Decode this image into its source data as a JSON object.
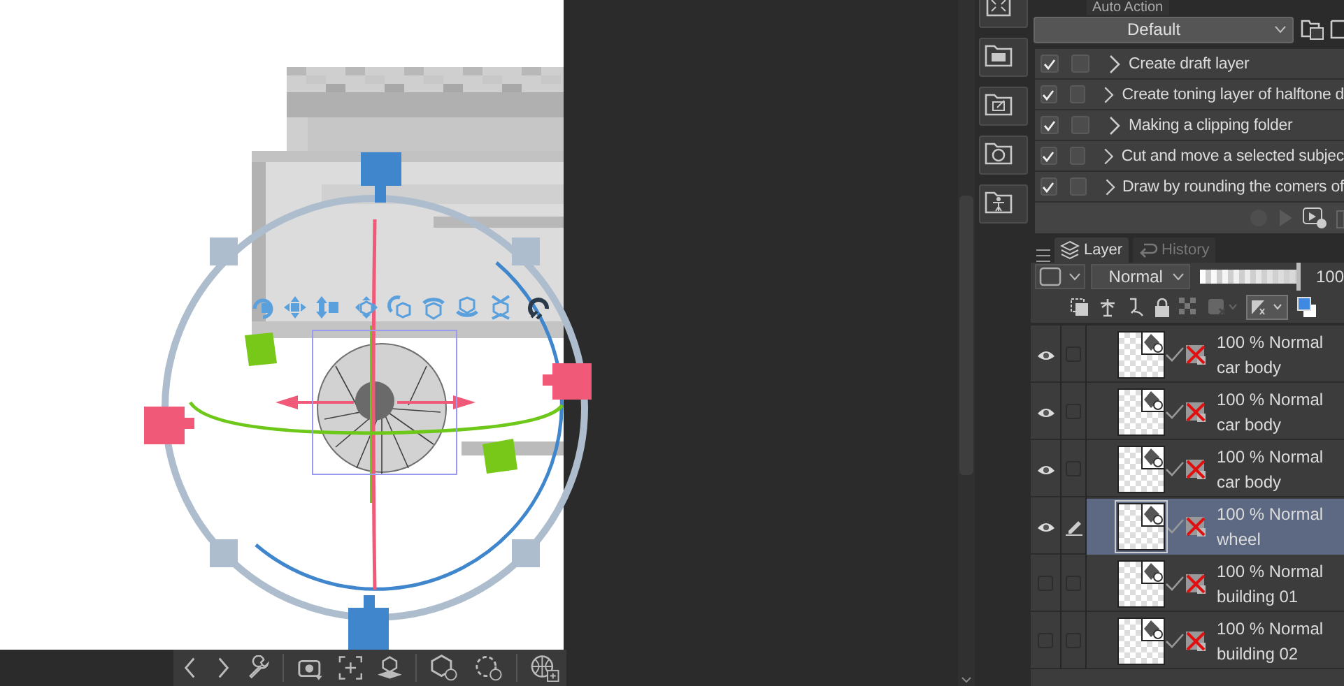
{
  "auto_action": {
    "tab": "Auto Action",
    "set": "Default",
    "actions": [
      {
        "label": "Create draft layer",
        "checked": true,
        "dialog": false
      },
      {
        "label": "Create toning layer of halftone d",
        "checked": true,
        "dialog": false
      },
      {
        "label": "Making a clipping folder",
        "checked": true,
        "dialog": false
      },
      {
        "label": "Cut and move a selected subjec",
        "checked": true,
        "dialog": false
      },
      {
        "label": "Draw by rounding the comers of",
        "checked": true,
        "dialog": false
      }
    ]
  },
  "layer_panel": {
    "tabs": [
      {
        "label": "Layer",
        "selected": true
      },
      {
        "label": "History",
        "selected": false
      }
    ],
    "blend_mode": "Normal",
    "opacity": {
      "level": 0.97,
      "reading": "100"
    },
    "layers": [
      {
        "info": "100 % Normal",
        "name": "car body",
        "visible": true,
        "editing": false,
        "selected": false
      },
      {
        "info": "100 % Normal",
        "name": "car body",
        "visible": true,
        "editing": false,
        "selected": false
      },
      {
        "info": "100 % Normal",
        "name": "car body",
        "visible": true,
        "editing": false,
        "selected": false
      },
      {
        "info": "100 % Normal",
        "name": "wheel",
        "visible": true,
        "editing": true,
        "selected": true
      },
      {
        "info": "100 % Normal",
        "name": "building 01",
        "visible": false,
        "editing": false,
        "selected": false
      },
      {
        "info": "100 % Normal",
        "name": "building 02",
        "visible": false,
        "editing": false,
        "selected": false
      }
    ]
  }
}
